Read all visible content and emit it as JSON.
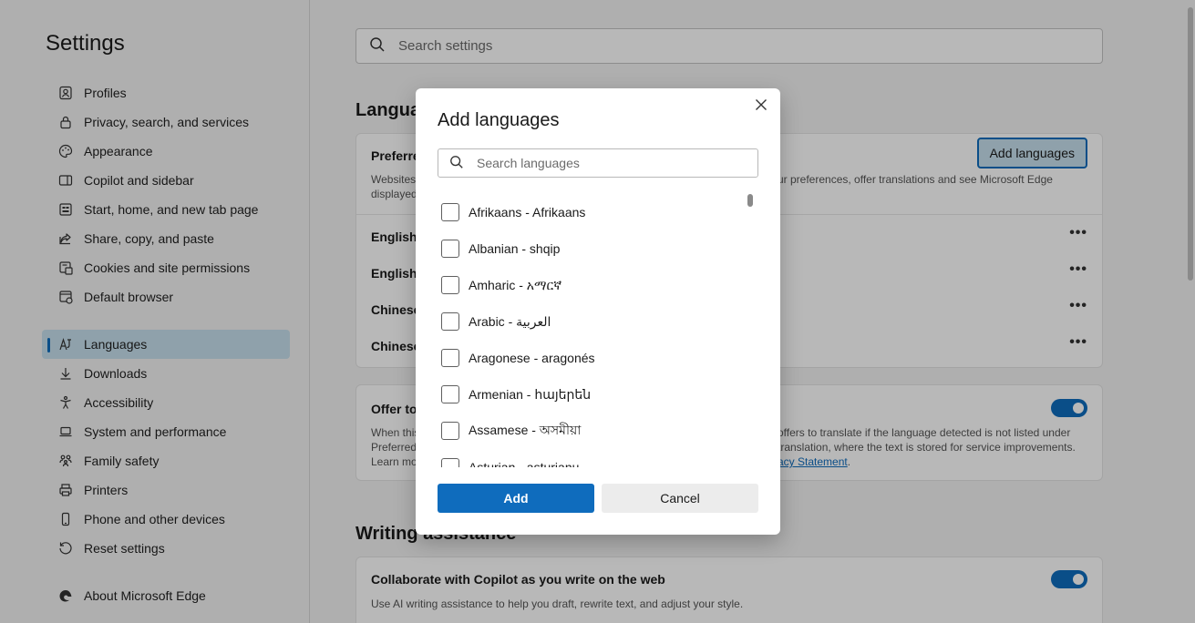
{
  "sidebar": {
    "title": "Settings",
    "items": [
      {
        "label": "Profiles",
        "icon": "profile-icon"
      },
      {
        "label": "Privacy, search, and services",
        "icon": "lock-icon"
      },
      {
        "label": "Appearance",
        "icon": "palette-icon"
      },
      {
        "label": "Copilot and sidebar",
        "icon": "sidebar-icon"
      },
      {
        "label": "Start, home, and new tab page",
        "icon": "home-icon"
      },
      {
        "label": "Share, copy, and paste",
        "icon": "share-icon"
      },
      {
        "label": "Cookies and site permissions",
        "icon": "cookie-icon"
      },
      {
        "label": "Default browser",
        "icon": "browser-icon"
      },
      {
        "label": "Languages",
        "icon": "languages-icon"
      },
      {
        "label": "Downloads",
        "icon": "download-icon"
      },
      {
        "label": "Accessibility",
        "icon": "accessibility-icon"
      },
      {
        "label": "System and performance",
        "icon": "laptop-icon"
      },
      {
        "label": "Family safety",
        "icon": "family-icon"
      },
      {
        "label": "Printers",
        "icon": "printer-icon"
      },
      {
        "label": "Phone and other devices",
        "icon": "phone-icon"
      },
      {
        "label": "Reset settings",
        "icon": "reset-icon"
      },
      {
        "label": "About Microsoft Edge",
        "icon": "edge-logo-icon"
      }
    ],
    "active": "Languages"
  },
  "search": {
    "placeholder": "Search settings"
  },
  "main": {
    "languages_title": "Langua",
    "preferred_label": "Preferre",
    "preferred_desc_left_1": "Websites",
    "preferred_desc_left_2": "displayed",
    "preferred_desc_right": "ur preferences, offer translations and see Microsoft Edge",
    "add_languages_label": "Add languages",
    "lang_rows": [
      "English",
      "English",
      "Chinese",
      "Chinese"
    ],
    "more_label": "•••",
    "offer_title": "Offer to",
    "offer_desc_left": [
      "When this",
      "Preferred",
      "Learn mo"
    ],
    "offer_desc_right": [
      "offers to translate if the language detected is not listed under",
      "translation, where the text is stored for service improvements.",
      "acy Statement"
    ],
    "offer_desc_period": ".",
    "writing_title": "Writing assistance",
    "copilot_title": "Collaborate with Copilot as you write on the web",
    "copilot_desc": "Use AI writing assistance to help you draft, rewrite text, and adjust your style."
  },
  "dialog": {
    "title": "Add languages",
    "search_placeholder": "Search languages",
    "languages": [
      "Afrikaans - Afrikaans",
      "Albanian - shqip",
      "Amharic - አማርኛ",
      "Arabic - العربية",
      "Aragonese - aragonés",
      "Armenian - հայերեն",
      "Assamese - অসমীয়া",
      "Asturian - asturianu"
    ],
    "add_label": "Add",
    "cancel_label": "Cancel"
  },
  "colors": {
    "accent": "#0f6cbd",
    "active_bg": "#c7e0ee"
  }
}
